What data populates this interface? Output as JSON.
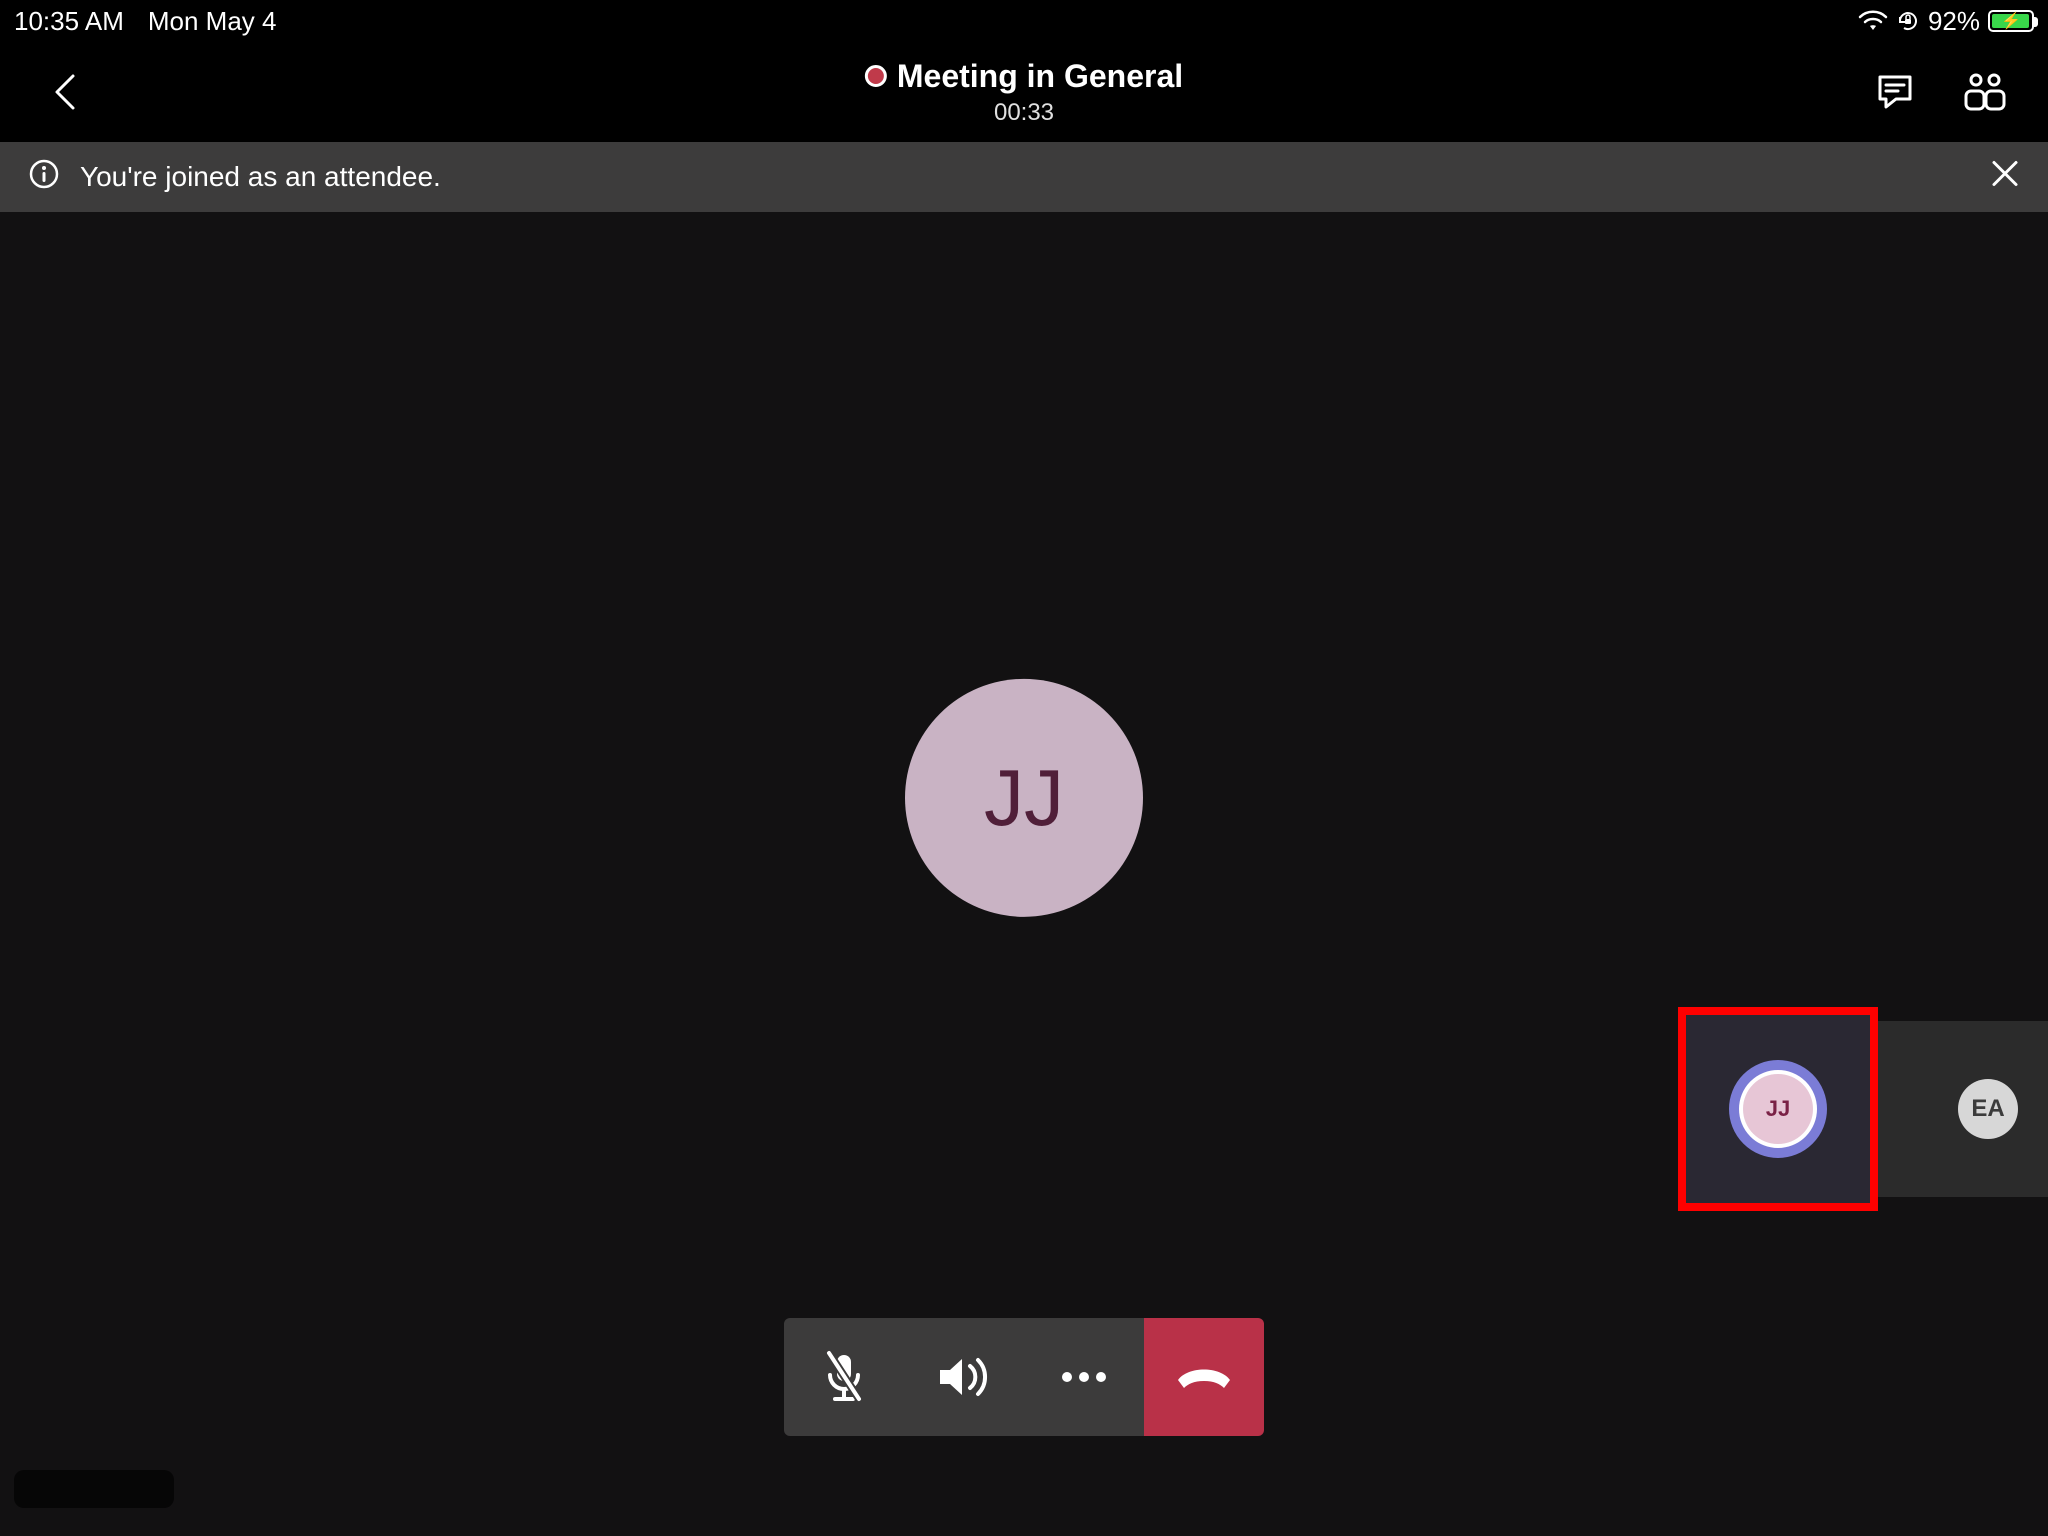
{
  "status_bar": {
    "time": "10:35 AM",
    "date": "Mon May 4",
    "battery_percent": "92%"
  },
  "header": {
    "title": "Meeting in General",
    "timer": "00:33"
  },
  "notice": {
    "text": "You're joined as an attendee."
  },
  "participants": {
    "main_initials": "JJ",
    "thumb_selected_initials": "JJ",
    "thumb_other_initials": "EA"
  }
}
